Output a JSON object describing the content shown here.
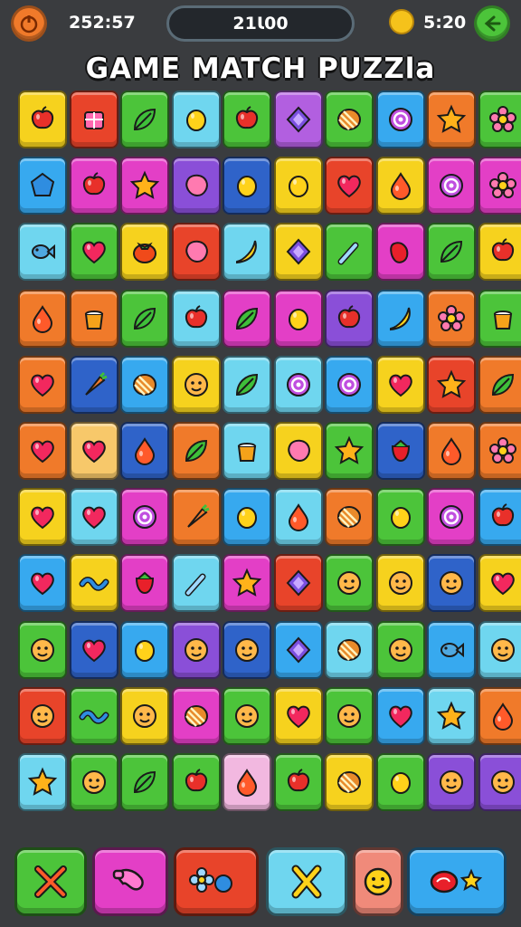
{
  "header": {
    "moves_text": "252:57",
    "score_text": "21Ɩ00",
    "timer_text": "5:20",
    "home_icon": "home-icon",
    "back_icon": "back-arrow-icon",
    "coin_icon": "coin-icon"
  },
  "title": "GAME MATCH PUZZla",
  "board": {
    "rows": [
      [
        [
          "#f6d21e",
          "apple"
        ],
        [
          "#e8442a",
          "gift"
        ],
        [
          "#4cc43a",
          "leaf"
        ],
        [
          "#6fd6ef",
          "lemon"
        ],
        [
          "#4cc43a",
          "apple"
        ],
        [
          "#b25fe0",
          "diamond"
        ],
        [
          "#4cc43a",
          "candy"
        ],
        [
          "#37a9ef",
          "swirl"
        ],
        [
          "#f07a2a",
          "star"
        ],
        [
          "#4cc43a",
          "flower"
        ]
      ],
      [
        [
          "#37a9ef",
          "pentagon"
        ],
        [
          "#e33fc6",
          "apple"
        ],
        [
          "#e33fc6",
          "star"
        ],
        [
          "#8a4fd8",
          "blob"
        ],
        [
          "#2f63c9",
          "lemon"
        ],
        [
          "#f6d21e",
          "lemon"
        ],
        [
          "#e8442a",
          "heart"
        ],
        [
          "#f6d21e",
          "drop"
        ],
        [
          "#e33fc6",
          "swirl"
        ],
        [
          "#e33fc6",
          "flower"
        ]
      ],
      [
        [
          "#6fd6ef",
          "fish"
        ],
        [
          "#4cc43a",
          "heart"
        ],
        [
          "#f6d21e",
          "tomato"
        ],
        [
          "#e8442a",
          "blob"
        ],
        [
          "#6fd6ef",
          "banana"
        ],
        [
          "#f6d21e",
          "diamond"
        ],
        [
          "#4cc43a",
          "wand"
        ],
        [
          "#e33fc6",
          "pepper"
        ],
        [
          "#4cc43a",
          "leaf"
        ],
        [
          "#f6d21e",
          "apple"
        ]
      ],
      [
        [
          "#f07a2a",
          "drop"
        ],
        [
          "#f07a2a",
          "cup"
        ],
        [
          "#4cc43a",
          "leaf"
        ],
        [
          "#6fd6ef",
          "apple"
        ],
        [
          "#e33fc6",
          "leaf"
        ],
        [
          "#e33fc6",
          "lemon"
        ],
        [
          "#8a4fd8",
          "apple"
        ],
        [
          "#37a9ef",
          "banana"
        ],
        [
          "#f07a2a",
          "flower"
        ],
        [
          "#4cc43a",
          "cup"
        ]
      ],
      [
        [
          "#f07a2a",
          "heart"
        ],
        [
          "#2f63c9",
          "carrot"
        ],
        [
          "#37a9ef",
          "candy"
        ],
        [
          "#f6d21e",
          "face"
        ],
        [
          "#6fd6ef",
          "leaf"
        ],
        [
          "#6fd6ef",
          "swirl"
        ],
        [
          "#37a9ef",
          "swirl"
        ],
        [
          "#f6d21e",
          "heart"
        ],
        [
          "#e8442a",
          "star"
        ],
        [
          "#f07a2a",
          "leaf"
        ]
      ],
      [
        [
          "#f07a2a",
          "heart"
        ],
        [
          "#f7c86a",
          "heart"
        ],
        [
          "#2f63c9",
          "drop"
        ],
        [
          "#f07a2a",
          "leaf"
        ],
        [
          "#6fd6ef",
          "cup"
        ],
        [
          "#f6d21e",
          "blob"
        ],
        [
          "#4cc43a",
          "star"
        ],
        [
          "#2f63c9",
          "berry"
        ],
        [
          "#f07a2a",
          "drop"
        ],
        [
          "#f07a2a",
          "flower"
        ]
      ],
      [
        [
          "#f6d21e",
          "heart"
        ],
        [
          "#6fd6ef",
          "heart"
        ],
        [
          "#e33fc6",
          "swirl"
        ],
        [
          "#f07a2a",
          "carrot"
        ],
        [
          "#37a9ef",
          "lemon"
        ],
        [
          "#6fd6ef",
          "drop"
        ],
        [
          "#f07a2a",
          "candy"
        ],
        [
          "#4cc43a",
          "lemon"
        ],
        [
          "#e33fc6",
          "swirl"
        ],
        [
          "#37a9ef",
          "apple"
        ]
      ],
      [
        [
          "#37a9ef",
          "heart"
        ],
        [
          "#f6d21e",
          "wave"
        ],
        [
          "#e33fc6",
          "berry"
        ],
        [
          "#6fd6ef",
          "wand"
        ],
        [
          "#e33fc6",
          "star"
        ],
        [
          "#e8442a",
          "diamond"
        ],
        [
          "#4cc43a",
          "face"
        ],
        [
          "#f6d21e",
          "face"
        ],
        [
          "#2f63c9",
          "face"
        ],
        [
          "#f6d21e",
          "heart"
        ]
      ],
      [
        [
          "#4cc43a",
          "face"
        ],
        [
          "#2f63c9",
          "heart"
        ],
        [
          "#37a9ef",
          "lemon"
        ],
        [
          "#8a4fd8",
          "face"
        ],
        [
          "#2f63c9",
          "face"
        ],
        [
          "#37a9ef",
          "diamond"
        ],
        [
          "#6fd6ef",
          "candy"
        ],
        [
          "#4cc43a",
          "face"
        ],
        [
          "#37a9ef",
          "fish"
        ],
        [
          "#6fd6ef",
          "face"
        ]
      ],
      [
        [
          "#e8442a",
          "face"
        ],
        [
          "#4cc43a",
          "wave"
        ],
        [
          "#f6d21e",
          "face"
        ],
        [
          "#e33fc6",
          "candy"
        ],
        [
          "#4cc43a",
          "face"
        ],
        [
          "#f6d21e",
          "heart"
        ],
        [
          "#4cc43a",
          "face"
        ],
        [
          "#37a9ef",
          "heart"
        ],
        [
          "#6fd6ef",
          "star"
        ],
        [
          "#f07a2a",
          "drop"
        ]
      ],
      [
        [
          "#6fd6ef",
          "star"
        ],
        [
          "#4cc43a",
          "face"
        ],
        [
          "#4cc43a",
          "leaf"
        ],
        [
          "#4cc43a",
          "apple"
        ],
        [
          "#f2b8e0",
          "drop"
        ],
        [
          "#4cc43a",
          "apple"
        ],
        [
          "#f6d21e",
          "candy"
        ],
        [
          "#4cc43a",
          "lemon"
        ],
        [
          "#8a4fd8",
          "face"
        ],
        [
          "#8a4fd8",
          "face"
        ]
      ]
    ]
  },
  "powerups": [
    {
      "name": "powerup-crossed-tools",
      "bg": "#4cc43a",
      "icon": "crossed-tools-icon"
    },
    {
      "name": "powerup-hammer",
      "bg": "#e33fc6",
      "icon": "hammer-icon"
    },
    {
      "name": "powerup-combo",
      "bg": "#e8442a",
      "icon": "flower-combo-icon"
    },
    {
      "name": "powerup-shuffle",
      "bg": "#6fd6ef",
      "icon": "x-shuffle-icon"
    },
    {
      "name": "powerup-face",
      "bg": "#f08a7a",
      "icon": "face-icon"
    },
    {
      "name": "powerup-bomb",
      "bg": "#37a9ef",
      "icon": "bomb-sun-icon"
    }
  ]
}
